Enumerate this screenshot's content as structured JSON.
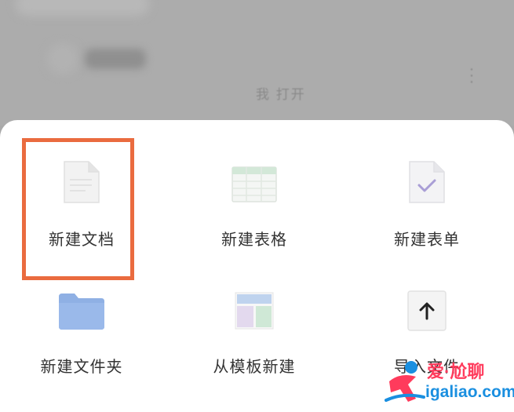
{
  "background": {
    "blurred_text": "我 打开"
  },
  "sheet": {
    "items": [
      {
        "label": "新建文档",
        "icon": "document-icon"
      },
      {
        "label": "新建表格",
        "icon": "spreadsheet-icon"
      },
      {
        "label": "新建表单",
        "icon": "form-icon"
      },
      {
        "label": "新建文件夹",
        "icon": "folder-icon"
      },
      {
        "label": "从模板新建",
        "icon": "template-icon"
      },
      {
        "label": "导入文件",
        "icon": "upload-icon"
      }
    ]
  },
  "colors": {
    "highlight": "#ea6b3f",
    "folder": "#92b3e6",
    "label": "#333333"
  },
  "watermark": {
    "line1": "爱·尬聊",
    "line2": "igaliao.com"
  }
}
